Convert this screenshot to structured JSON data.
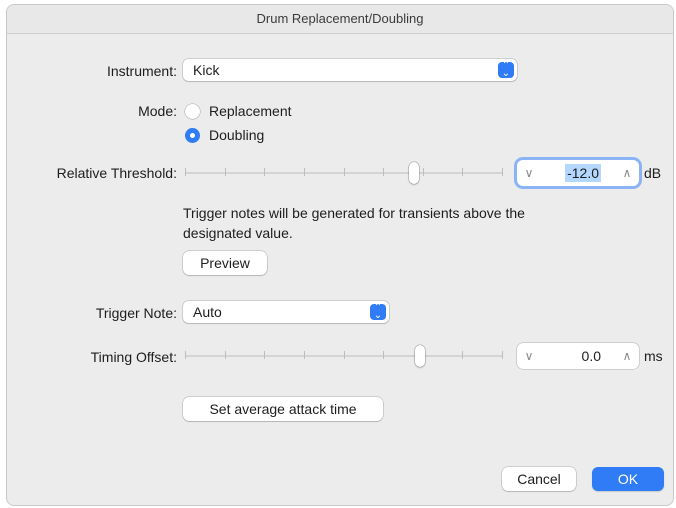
{
  "window": {
    "title": "Drum Replacement/Doubling"
  },
  "instrument": {
    "label": "Instrument:",
    "value": "Kick"
  },
  "mode": {
    "label": "Mode:",
    "options": [
      {
        "label": "Replacement",
        "selected": false
      },
      {
        "label": "Doubling",
        "selected": true
      }
    ]
  },
  "relative_threshold": {
    "label": "Relative Threshold:",
    "value": "-12.0",
    "unit": "dB",
    "slider_level": 0.72
  },
  "info_text": {
    "line1": "Trigger notes will be generated for transients above the",
    "line2": "designated value."
  },
  "preview_button": "Preview",
  "trigger_note": {
    "label": "Trigger Note:",
    "value": "Auto"
  },
  "timing_offset": {
    "label": "Timing Offset:",
    "value": "0.0",
    "unit": "ms",
    "slider_level": 0.74
  },
  "set_attack_button": "Set average attack time",
  "footer": {
    "cancel": "Cancel",
    "ok": "OK"
  },
  "colors": {
    "accent": "#2f7cf6",
    "focus_ring": "#8ab4f5",
    "selection": "#b3d7ff"
  }
}
